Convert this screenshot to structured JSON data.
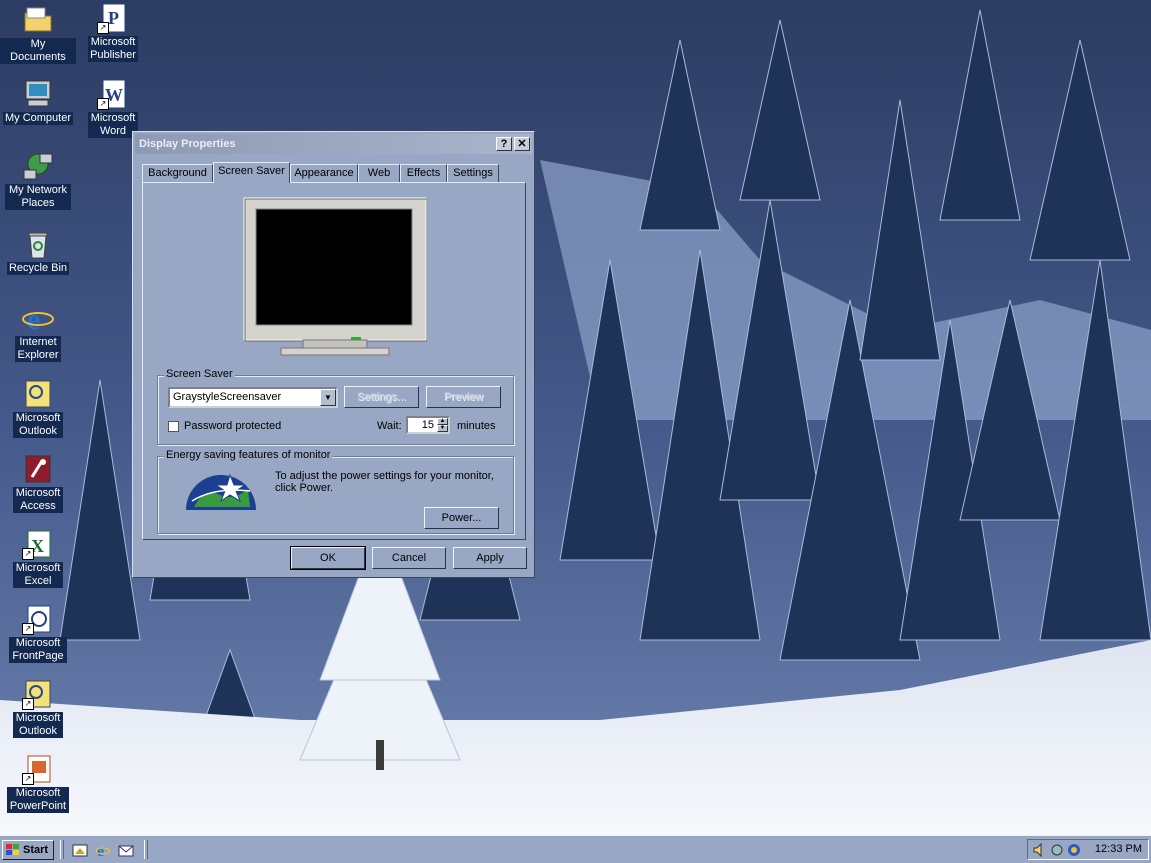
{
  "desktop": {
    "icons": [
      {
        "label": "My Documents",
        "icon": "folder-icon"
      },
      {
        "label": "Microsoft Publisher",
        "icon": "publisher-icon"
      },
      {
        "label": "My Computer",
        "icon": "computer-icon"
      },
      {
        "label": "Microsoft Word",
        "icon": "word-icon"
      },
      {
        "label": "My Network Places",
        "icon": "network-icon"
      },
      {
        "label": "Recycle Bin",
        "icon": "recycle-bin-icon"
      },
      {
        "label": "Internet Explorer",
        "icon": "ie-icon"
      },
      {
        "label": "Microsoft Outlook",
        "icon": "outlook-icon"
      },
      {
        "label": "Microsoft Access",
        "icon": "access-icon"
      },
      {
        "label": "Microsoft Excel",
        "icon": "excel-icon"
      },
      {
        "label": "Microsoft FrontPage",
        "icon": "frontpage-icon"
      },
      {
        "label": "Microsoft Outlook",
        "icon": "outlook-icon"
      },
      {
        "label": "Microsoft PowerPoint",
        "icon": "powerpoint-icon"
      }
    ]
  },
  "dialog": {
    "title": "Display Properties",
    "help_btn": "?",
    "close_btn": "✕",
    "tabs": [
      "Background",
      "Screen Saver",
      "Appearance",
      "Web",
      "Effects",
      "Settings"
    ],
    "active_tab": "Screen Saver",
    "screensaver": {
      "group_label": "Screen Saver",
      "selected": "GraystyleScreensaver",
      "settings_btn": "Settings...",
      "preview_btn": "Preview",
      "password_label": "Password protected",
      "password_checked": false,
      "wait_label": "Wait:",
      "wait_value": "15",
      "wait_unit": "minutes"
    },
    "energy": {
      "group_label": "Energy saving features of monitor",
      "text_line1": "To adjust the power settings for your monitor,",
      "text_line2": "click Power.",
      "power_btn": "Power..."
    },
    "ok_btn": "OK",
    "cancel_btn": "Cancel",
    "apply_btn": "Apply"
  },
  "taskbar": {
    "start_label": "Start",
    "clock": "12:33 PM"
  },
  "colors": {
    "dialog_bg": "#98a8c4",
    "titlebar": "#8d9ab3",
    "desktop_label_bg": "#13294f"
  }
}
